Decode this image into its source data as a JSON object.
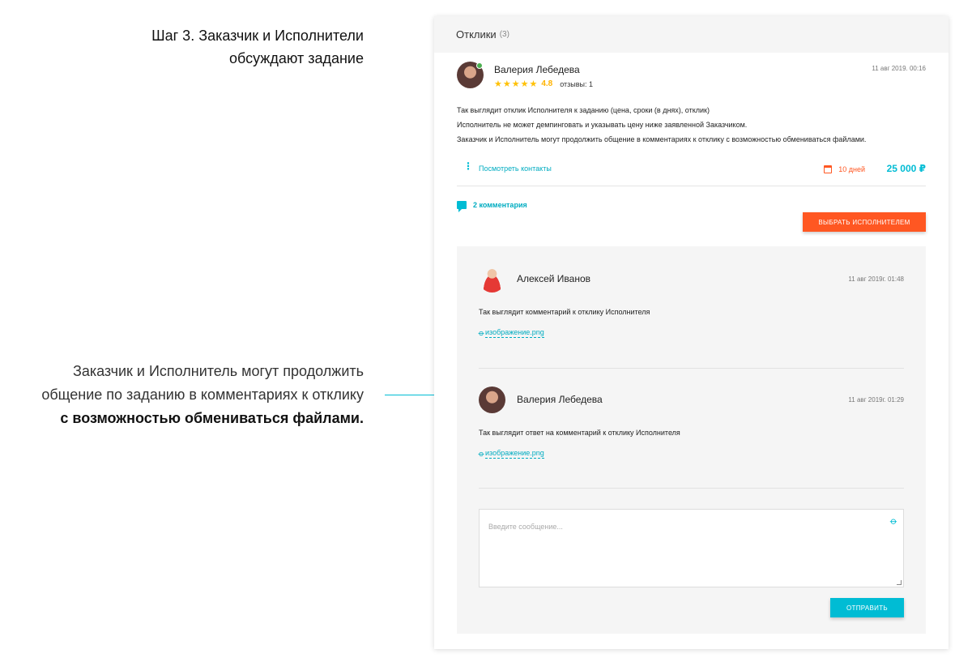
{
  "intro": {
    "step_line1": "Шаг 3. Заказчик и Исполнители",
    "step_line2": "обсуждают задание"
  },
  "annotation": {
    "line1": "Заказчик и Исполнитель могут продолжить",
    "line2": "общение по заданию в комментариях к отклику",
    "line3": "с возможностью обмениваться файлами."
  },
  "card": {
    "title": "Отклики",
    "count": "(3)"
  },
  "response": {
    "name": "Валерия Лебедева",
    "stars": "★★★★★",
    "rating": "4.8",
    "reviews": "отзывы: 1",
    "date": "11 авг 2019. 00:16",
    "text_line1": "Так выглядит отклик Исполнителя к заданию (цена, сроки (в днях), отклик)",
    "text_line2": "Исполнитель не может демпинговать и указывать цену ниже заявленной Заказчиком.",
    "text_line3": "Заказчик и Исполнитель могут продолжить общение в комментариях к отклику с возможностью обмениваться файлами.",
    "contacts_link": "Посмотреть контакты",
    "days": "10 дней",
    "price": "25 000 ₽",
    "comments_link": "2 комментария",
    "choose_button": "ВЫБРАТЬ ИСПОЛНИТЕЛЕМ"
  },
  "comments": [
    {
      "name": "Алексей Иванов",
      "date": "11 авг 2019г. 01:48",
      "text": "Так выглядит комментарий к отклику Исполнителя",
      "file": "изображение.png"
    },
    {
      "name": "Валерия Лебедева",
      "date": "11 авг 2019г. 01:29",
      "text": "Так выглядит ответ на комментарий к отклику Исполнителя",
      "file": "изображение.png"
    }
  ],
  "composer": {
    "placeholder": "Введите сообщение...",
    "send_button": "ОТПРАВИТЬ"
  },
  "colors": {
    "accent": "#00bcd4",
    "action": "#ff5722",
    "star": "#ffc107"
  }
}
